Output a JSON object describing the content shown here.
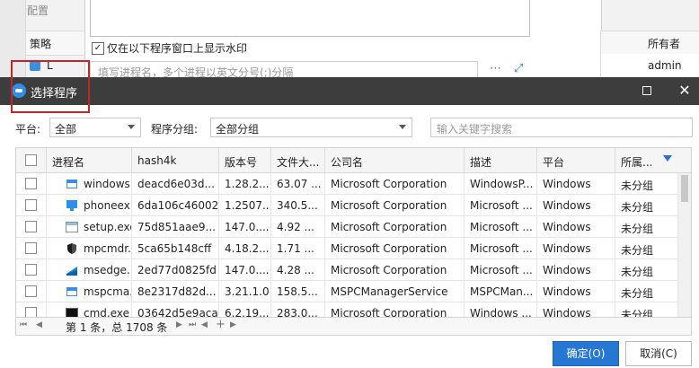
{
  "background": {
    "config_label": "配置",
    "show_watermark_label": "仅在以下程序窗口上显示水印",
    "process_input_placeholder": "填写进程名，多个进程以英文分号(;)分隔",
    "left_header": "策略",
    "left_row_label": "L",
    "right_header": "所有者",
    "right_cell": "admin"
  },
  "dialog": {
    "title": "选择程序",
    "platform_label": "平台:",
    "platform_value": "全部",
    "group_label": "程序分组:",
    "group_value": "全部分组",
    "search_placeholder": "输入关键字搜索",
    "columns": [
      "进程名",
      "hash4k",
      "版本号",
      "文件大...",
      "公司名",
      "描述",
      "平台",
      "所属..."
    ],
    "rows": [
      {
        "icon": "window-icon",
        "name": "windows...",
        "hash": "deacd6e03d...",
        "version": "1.28.2...",
        "size": "63.07 ...",
        "company": "Microsoft Corporation",
        "desc": "WindowsP...",
        "platform": "Windows",
        "group": "未分组"
      },
      {
        "icon": "monitor-icon",
        "name": "phoneex...",
        "hash": "6da106c46002",
        "version": "1.2507...",
        "size": "340.5...",
        "company": "Microsoft Corporation",
        "desc": "Microsoft ...",
        "platform": "Windows",
        "group": "未分组"
      },
      {
        "icon": "app-window-icon",
        "name": "setup.exe",
        "hash": "75d851aae9...",
        "version": "147.0....",
        "size": "4.92 ...",
        "company": "Microsoft Corporation",
        "desc": "Microsoft ...",
        "platform": "Windows",
        "group": "未分组"
      },
      {
        "icon": "shield-icon",
        "name": "mpcmdr...",
        "hash": "5ca65b148cff",
        "version": "4.18.2...",
        "size": "1.71 ...",
        "company": "Microsoft Corporation",
        "desc": "Microsoft ...",
        "platform": "Windows",
        "group": "未分组"
      },
      {
        "icon": "edge-icon",
        "name": "msedge...",
        "hash": "2ed77d0825fd",
        "version": "147.0....",
        "size": "4.28 ...",
        "company": "Microsoft Corporation",
        "desc": "Microsoft ...",
        "platform": "Windows",
        "group": "未分组"
      },
      {
        "icon": "window-icon",
        "name": "mspcma...",
        "hash": "8e2317d82d...",
        "version": "3.21.1.0",
        "size": "158.5...",
        "company": "MSPCManagerService",
        "desc": "MSPCMan...",
        "platform": "Windows",
        "group": "未分组"
      },
      {
        "icon": "terminal-icon",
        "name": "cmd.exe",
        "hash": "03642d5e9aca",
        "version": "6.2.19...",
        "size": "283.0...",
        "company": "Microsoft Corporation",
        "desc": "Windows ...",
        "platform": "Windows",
        "group": "未分组"
      }
    ],
    "pager_text": "第 1 条，总 1708 条",
    "pager_add": "+",
    "ok_label": "确定(O)",
    "cancel_label": "取消(C)"
  }
}
